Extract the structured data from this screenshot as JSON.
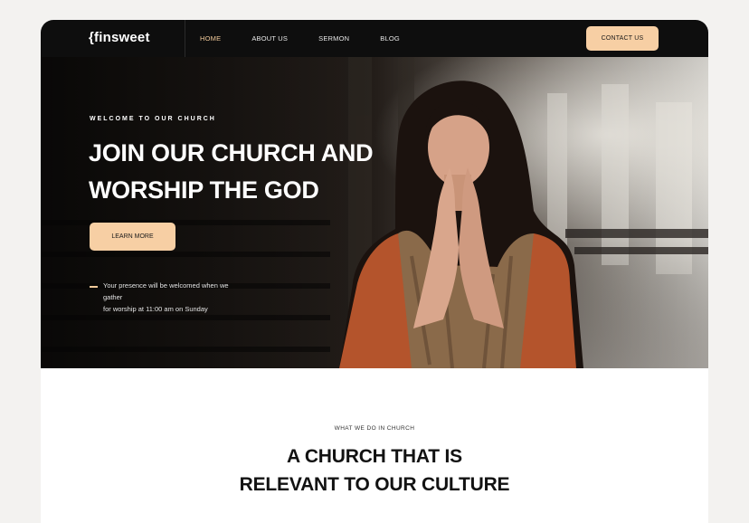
{
  "nav": {
    "logo": "{finsweet",
    "links": [
      "HOME",
      "ABOUT US",
      "SERMON",
      "BLOG"
    ],
    "active_index": 0,
    "contact_label": "CONTACT US"
  },
  "hero": {
    "eyebrow": "WELCOME TO OUR CHURCH",
    "title_line1": "JOIN OUR CHURCH AND",
    "title_line2": "WORSHIP THE GOD",
    "cta_label": "LEARN MORE",
    "note_line1": "Your presence will be welcomed when we gather",
    "note_line2": "for worship at 11:00 am on Sunday"
  },
  "section": {
    "eyebrow": "WHAT WE DO IN CHURCH",
    "title_line1": "A CHURCH THAT IS",
    "title_line2": "RELEVANT TO OUR CULTURE"
  },
  "colors": {
    "accent": "#f7cfa4",
    "nav_bg": "#0e0e0e",
    "active_link": "#f0c99a"
  }
}
